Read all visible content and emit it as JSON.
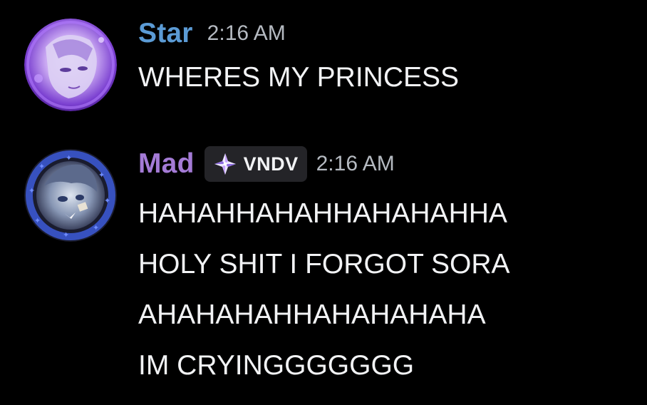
{
  "messages": [
    {
      "username": "Star",
      "username_color": "#5b9bd5",
      "timestamp": "2:16 AM",
      "avatar_icon": "anime-character-avatar-purple",
      "lines": [
        "WHERES MY PRINCESS"
      ]
    },
    {
      "username": "Mad",
      "username_color": "#a47bd6",
      "timestamp": "2:16 AM",
      "avatar_icon": "anime-character-avatar-rune-ring",
      "badge": {
        "label": "VNDV",
        "icon": "sparkle-diamond-icon"
      },
      "lines": [
        "HAHAHHAHAHHAHAHAHHA",
        "HOLY SHIT I FORGOT SORA",
        "AHAHAHAHHAHAHAHAHA",
        "IM CRYINGGGGGGG"
      ]
    }
  ]
}
